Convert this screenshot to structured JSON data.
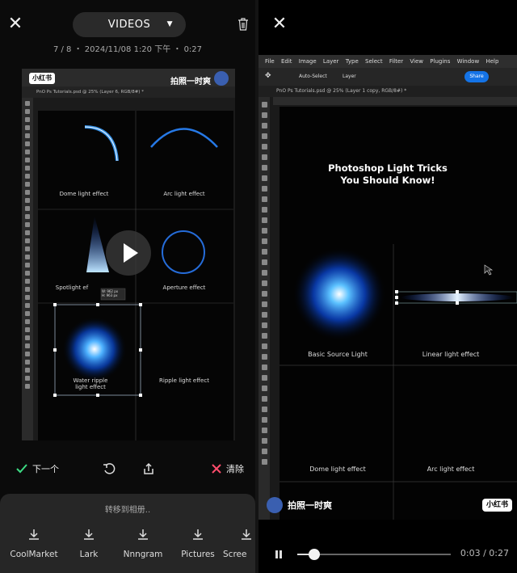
{
  "left": {
    "close_icon": "close-icon",
    "dropdown_label": "VIDEOS",
    "meta": "7 / 8 ・ 2024/11/08 1:20 下午 ・ 0:27",
    "preview": {
      "tab_text": "PnO Ps Tutorials.psd @ 25% (Layer 6, RGB/8#) *",
      "badge": "小红书",
      "brand": "拍照一时爽",
      "cells": [
        "Dome light effect",
        "Arc light effect",
        "Spotlight ef",
        "Aperture effect",
        "Water ripple\nlight effect",
        "Ripple light effect"
      ],
      "tooltip": "W: 962 px\nH: 963 px"
    },
    "actions": {
      "next": "下一个",
      "delete": "清除"
    },
    "sheet": {
      "title": "转移到相册..",
      "destinations": [
        "CoolMarket",
        "Lark",
        "Nnngram",
        "Pictures",
        "Scree"
      ]
    }
  },
  "right": {
    "menu": [
      "File",
      "Edit",
      "Image",
      "Layer",
      "Type",
      "Select",
      "Filter",
      "View",
      "Plugins",
      "Window",
      "Help"
    ],
    "options": {
      "auto_select": "Auto-Select",
      "layer": "Layer",
      "share": "Share"
    },
    "tab_text": "PnO Ps Tutorials.psd @ 25% (Layer 1 copy, RGB/8#) *",
    "title": "Photoshop Light Tricks\nYou Should Know!",
    "cells": [
      "Basic Source Light",
      "Linear light effect",
      "Dome light effect",
      "Arc light effect"
    ],
    "brand": "拍照一时爽",
    "badge": "小红书",
    "player": {
      "time": "0:03 / 0:27",
      "progress": 0.11
    }
  },
  "colors": {
    "glow": "#2a8bff",
    "check": "#3ddc84",
    "delete": "#ff4d6d",
    "share": "#1473e6"
  }
}
